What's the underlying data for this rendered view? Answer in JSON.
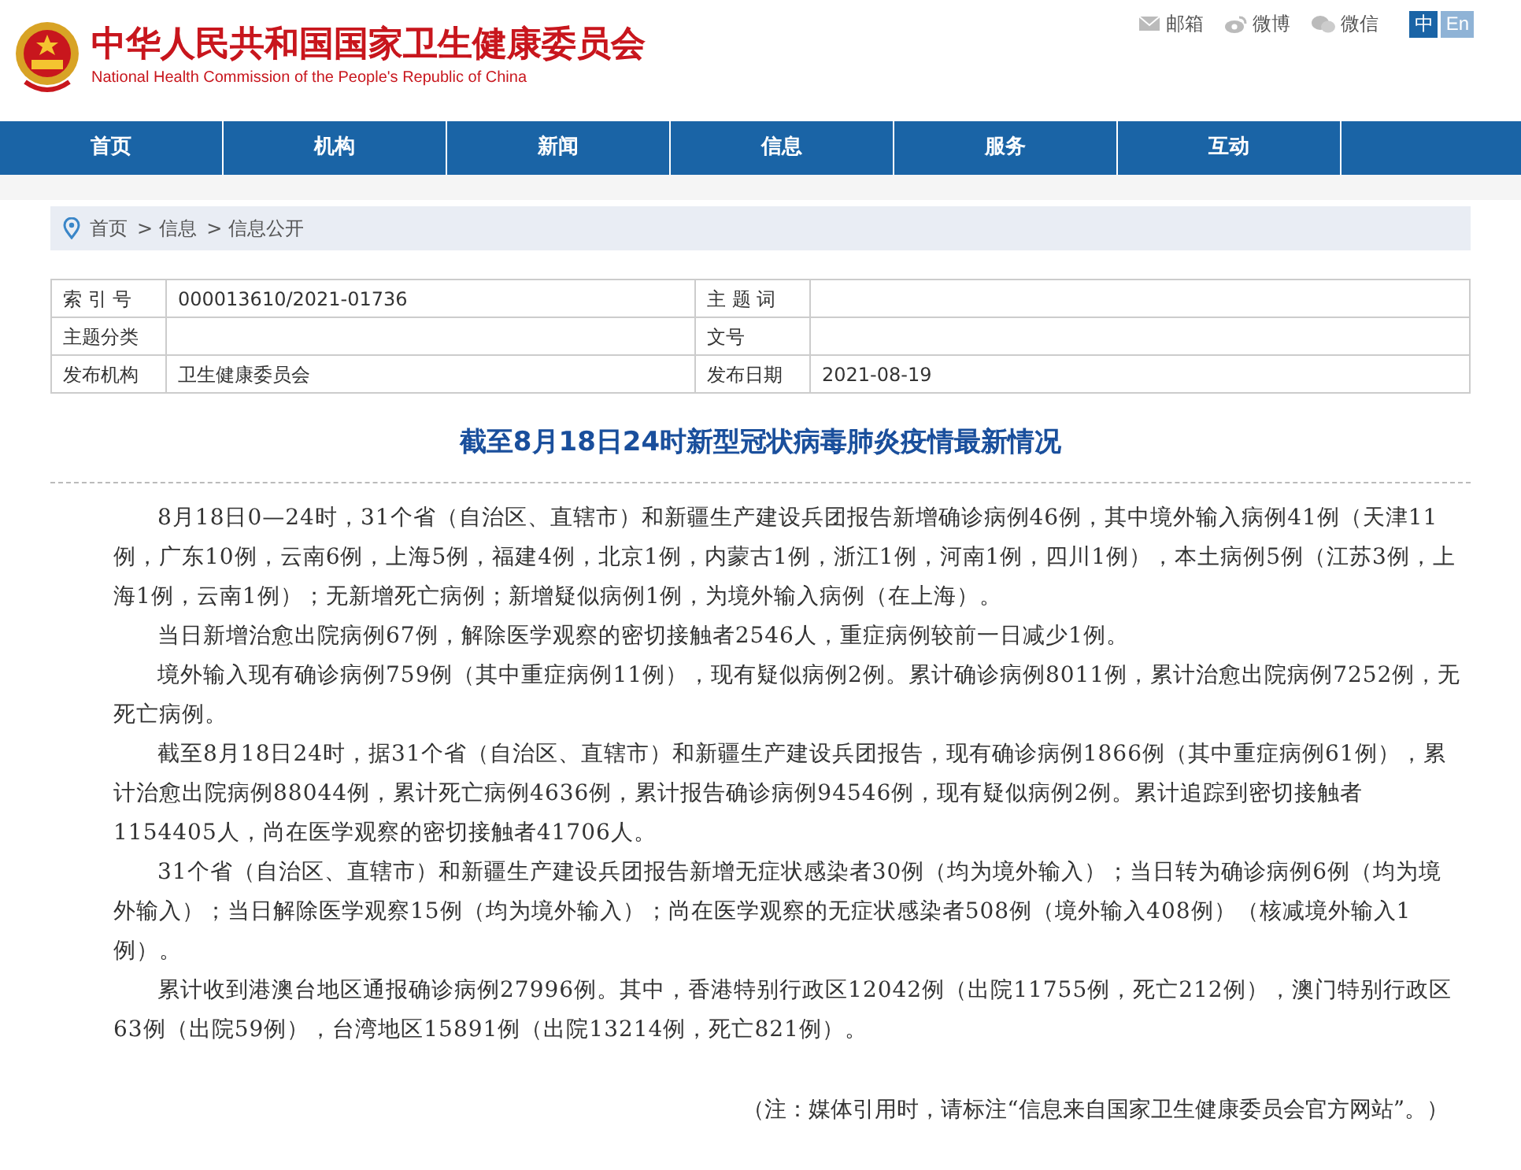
{
  "header": {
    "title": "中华人民共和国国家卫生健康委员会",
    "subtitle": "National Health Commission of the People's Republic of China",
    "links": [
      {
        "kind": "mail",
        "label": "邮箱"
      },
      {
        "kind": "weibo",
        "label": "微博"
      },
      {
        "kind": "wechat",
        "label": "微信"
      }
    ],
    "languages": [
      {
        "label": "中",
        "selected": true
      },
      {
        "label": "En",
        "selected": false
      }
    ]
  },
  "nav": [
    {
      "label": "首页"
    },
    {
      "label": "机构"
    },
    {
      "label": "新闻"
    },
    {
      "label": "信息"
    },
    {
      "label": "服务"
    },
    {
      "label": "互动"
    }
  ],
  "breadcrumb": {
    "separator": ">",
    "items": [
      "首页",
      "信息",
      "信息公开"
    ]
  },
  "meta_table": [
    [
      {
        "label": "索 引 号",
        "value": "000013610/2021-01736"
      },
      {
        "label": "主 题 词"
      }
    ],
    [
      {
        "label": "主题分类"
      },
      {
        "label": "文号"
      }
    ],
    [
      {
        "label": "发布机构",
        "value": "卫生健康委员会"
      },
      {
        "label": "发布日期",
        "value": "2021-08-19"
      }
    ]
  ],
  "article": {
    "title": "截至8月18日24时新型冠状病毒肺炎疫情最新情况",
    "paragraphs": [
      "8月18日0—24时，31个省（自治区、直辖市）和新疆生产建设兵团报告新增确诊病例46例，其中境外输入病例41例（天津11例，广东10例，云南6例，上海5例，福建4例，北京1例，内蒙古1例，浙江1例，河南1例，四川1例），本土病例5例（江苏3例，上海1例，云南1例）；无新增死亡病例；新增疑似病例1例，为境外输入病例（在上海）。",
      "当日新增治愈出院病例67例，解除医学观察的密切接触者2546人，重症病例较前一日减少1例。",
      "境外输入现有确诊病例759例（其中重症病例11例），现有疑似病例2例。累计确诊病例8011例，累计治愈出院病例7252例，无死亡病例。",
      "截至8月18日24时，据31个省（自治区、直辖市）和新疆生产建设兵团报告，现有确诊病例1866例（其中重症病例61例），累计治愈出院病例88044例，累计死亡病例4636例，累计报告确诊病例94546例，现有疑似病例2例。累计追踪到密切接触者1154405人，尚在医学观察的密切接触者41706人。",
      "31个省（自治区、直辖市）和新疆生产建设兵团报告新增无症状感染者30例（均为境外输入）；当日转为确诊病例6例（均为境外输入）；当日解除医学观察15例（均为境外输入）；尚在医学观察的无症状感染者508例（境外输入408例）（核减境外输入1例）。",
      "累计收到港澳台地区通报确诊病例27996例。其中，香港特别行政区12042例（出院11755例，死亡212例），澳门特别行政区63例（出院59例），台湾地区15891例（出院13214例，死亡821例）。"
    ],
    "note": "（注：媒体引用时，请标注“信息来自国家卫生健康委员会官方网站”。）"
  }
}
